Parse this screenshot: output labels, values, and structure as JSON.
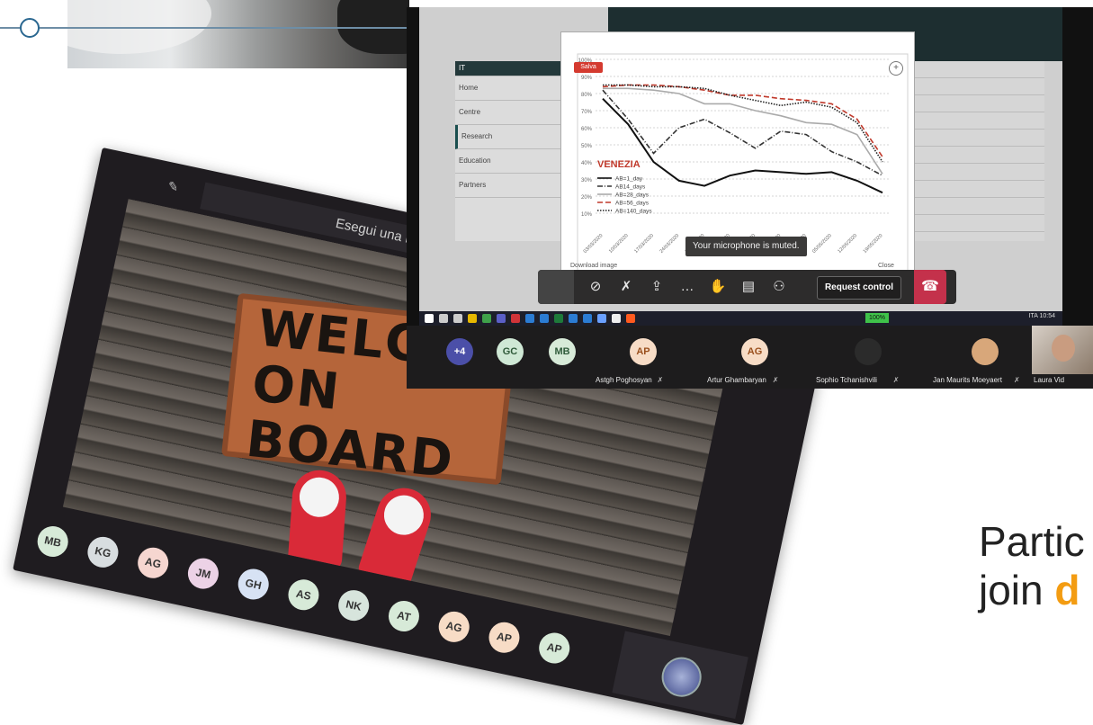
{
  "big_window": {
    "search_placeholder": "Esegui una ricerca o digita un co",
    "photo_text_line1": "WELCO",
    "photo_text_line2": "ON BOARD",
    "avatars": [
      "MB",
      "KG",
      "AG",
      "JM",
      "GH",
      "AS",
      "NK",
      "AT",
      "AG",
      "AP",
      "AP"
    ]
  },
  "share_window": {
    "sidebar_items": [
      "IT",
      "Home",
      "Centre",
      "Research",
      "Education",
      "Partners"
    ],
    "chart_modal": {
      "salva_label": "Salva",
      "download_label": "Download image",
      "close_label": "Close",
      "chart_data": {
        "type": "line",
        "title": "VENEZIA",
        "categories": [
          "03/03/2020",
          "10/03/2020",
          "17/03/2020",
          "24/03/2020",
          "31/03/2020",
          "07/04/2020",
          "14/04/2020",
          "21/04/2020",
          "28/04/2020",
          "05/05/2020",
          "12/05/2020",
          "19/05/2020"
        ],
        "ylim": [
          0,
          100
        ],
        "yticks": [
          "10%",
          "20%",
          "30%",
          "40%",
          "50%",
          "60%",
          "70%",
          "80%",
          "90%",
          "100%"
        ],
        "grid": true,
        "legend_position": "left",
        "series": [
          {
            "name": "AB=1_day",
            "values": [
              77,
              62,
              40,
              29,
              26,
              32,
              35,
              34,
              33,
              34,
              29,
              22
            ],
            "color": "#111111",
            "style": "solid"
          },
          {
            "name": "AB14_days",
            "values": [
              82,
              65,
              45,
              60,
              65,
              57,
              48,
              58,
              56,
              46,
              40,
              32
            ],
            "color": "#333333",
            "style": "dashdot"
          },
          {
            "name": "AB=28_days",
            "values": [
              83,
              83,
              82,
              80,
              74,
              74,
              70,
              67,
              63,
              62,
              56,
              33
            ],
            "color": "#aaaaaa",
            "style": "solid"
          },
          {
            "name": "AB=56_days",
            "values": [
              84,
              85,
              85,
              84,
              82,
              79,
              79,
              77,
              76,
              74,
              65,
              43
            ],
            "color": "#c0392b",
            "style": "dashed"
          },
          {
            "name": "AB=140_days",
            "values": [
              85,
              85,
              84,
              84,
              83,
              79,
              76,
              73,
              75,
              72,
              63,
              40
            ],
            "color": "#222222",
            "style": "dotted"
          }
        ]
      }
    },
    "toast": "Your microphone is muted.",
    "toolbar": {
      "request_control": "Request control"
    },
    "taskbar": {
      "battery": "100%",
      "tray_text": "ITA  10:54"
    },
    "participants": [
      {
        "initials": "+4",
        "name": "",
        "color": "#4b4fa8",
        "text_color": "#ffffff"
      },
      {
        "initials": "GC",
        "name": "",
        "color": "#cfe8d5",
        "text_color": "#2f5a3a"
      },
      {
        "initials": "MB",
        "name": "",
        "color": "#d7ead8",
        "text_color": "#2f5a3a"
      },
      {
        "initials": "AP",
        "name": "Astgh Poghosyan",
        "color": "#f7dcc6",
        "text_color": "#9a4f1d"
      },
      {
        "initials": "AG",
        "name": "Artur Ghambaryan",
        "color": "#f7dcc6",
        "text_color": "#9a4f1d"
      },
      {
        "initials": "",
        "name": "Sophio Tchanishvili",
        "color": "#2b2b2b",
        "text_color": "#ffffff"
      },
      {
        "initials": "",
        "name": "Jan Maurits Moeyaert",
        "color": "#d8a77a",
        "text_color": "#ffffff"
      },
      {
        "initials": "",
        "name": "Laura Vid",
        "color": "#c99c80",
        "text_color": "#ffffff"
      }
    ]
  },
  "caption": {
    "line1": "Partic",
    "line2_prefix": "join ",
    "line2_highlight": "d"
  }
}
